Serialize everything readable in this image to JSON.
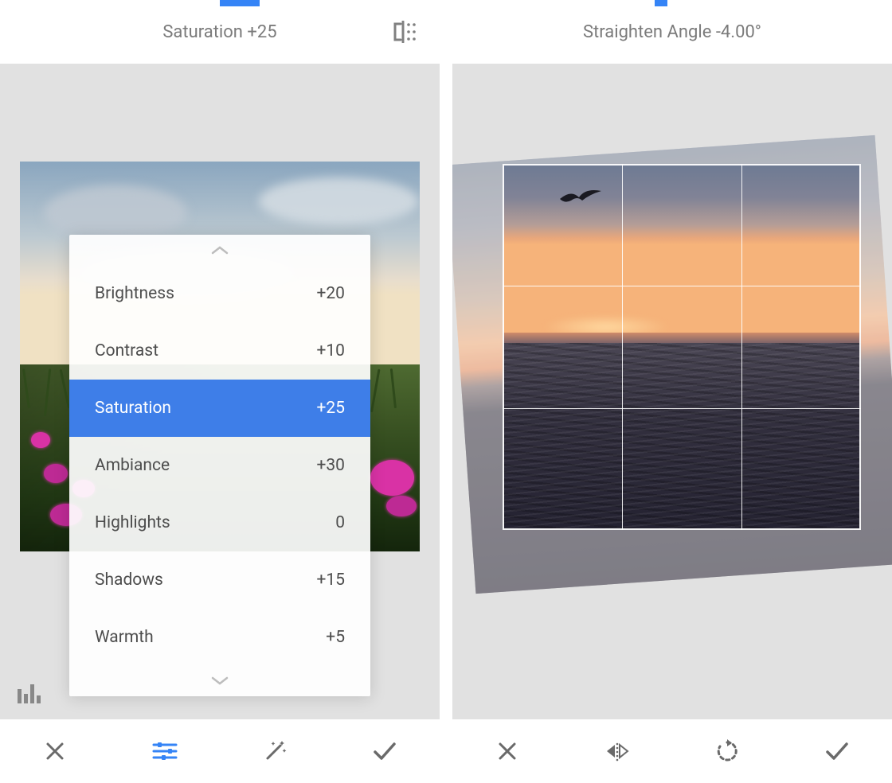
{
  "left": {
    "progress": {
      "left_pct": 50,
      "width_pct": 9
    },
    "header": {
      "title": "Saturation +25",
      "compare_icon": "compare-icon"
    },
    "panel": {
      "items": [
        {
          "label": "Brightness",
          "value": "+20",
          "selected": false
        },
        {
          "label": "Contrast",
          "value": "+10",
          "selected": false
        },
        {
          "label": "Saturation",
          "value": "+25",
          "selected": true
        },
        {
          "label": "Ambiance",
          "value": "+30",
          "selected": false
        },
        {
          "label": "Highlights",
          "value": "0",
          "selected": false
        },
        {
          "label": "Shadows",
          "value": "+15",
          "selected": false
        },
        {
          "label": "Warmth",
          "value": "+5",
          "selected": false
        }
      ]
    },
    "toolbar": {
      "items": [
        {
          "name": "close-button",
          "icon": "close-icon",
          "active": false
        },
        {
          "name": "tune-button",
          "icon": "sliders-icon",
          "active": true
        },
        {
          "name": "effects-button",
          "icon": "wand-icon",
          "active": false
        },
        {
          "name": "apply-button",
          "icon": "check-icon",
          "active": false
        }
      ]
    },
    "histogram_icon": "histogram-icon"
  },
  "right": {
    "progress": {
      "left_pct": 46,
      "width_pct": 3
    },
    "header": {
      "title": "Straighten Angle -4.00°"
    },
    "rotation_deg": -4,
    "toolbar": {
      "items": [
        {
          "name": "close-button",
          "icon": "close-icon",
          "active": false
        },
        {
          "name": "flip-button",
          "icon": "flip-horiz-icon",
          "active": false
        },
        {
          "name": "rotate-button",
          "icon": "rotate-cw-icon",
          "active": false
        },
        {
          "name": "apply-button",
          "icon": "check-icon",
          "active": false
        }
      ]
    }
  }
}
